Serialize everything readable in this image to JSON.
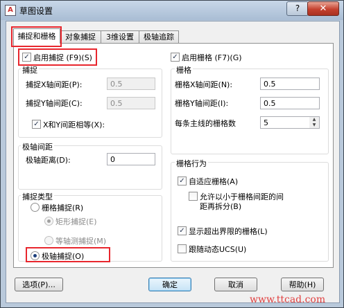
{
  "window": {
    "title": "草图设置",
    "help_label": "?",
    "close_label": "✕"
  },
  "tabs": [
    "捕捉和栅格",
    "对象捕捉",
    "3维设置",
    "极轴追踪"
  ],
  "left": {
    "snap_on_label": "启用捕捉 (F9)(S)",
    "snap_group_title": "捕捉",
    "snap_x_label": "捕捉X轴间距(P):",
    "snap_x_value": "0.5",
    "snap_y_label": "捕捉Y轴间距(C):",
    "snap_y_value": "0.5",
    "equal_xy_label": "X和Y间距相等(X):",
    "polar_group_title": "极轴间距",
    "polar_distance_label": "极轴距离(D):",
    "polar_distance_value": "0",
    "snap_type_title": "捕捉类型",
    "grid_snap_label": "栅格捕捉(R)",
    "rect_snap_label": "矩形捕捉(E)",
    "iso_snap_label": "等轴测捕捉(M)",
    "polar_snap_label": "极轴捕捉(O)"
  },
  "right": {
    "grid_on_label": "启用栅格 (F7)(G)",
    "grid_group_title": "栅格",
    "grid_x_label": "栅格X轴间距(N):",
    "grid_x_value": "0.5",
    "grid_y_label": "栅格Y轴间距(I):",
    "grid_y_value": "0.5",
    "major_line_label": "每条主线的栅格数",
    "major_line_value": "5",
    "behavior_title": "栅格行为",
    "adaptive_label": "自适应栅格(A)",
    "subdivide_label_1": "允许以小于栅格间距的间",
    "subdivide_label_2": "距再拆分(B)",
    "beyond_limits_label": "显示超出界限的栅格(L)",
    "follow_ucs_label": "跟随动态UCS(U)"
  },
  "buttons": {
    "options": "选项(P)...",
    "ok": "确定",
    "cancel": "取消",
    "help": "帮助(H)"
  },
  "watermark": "www.ttcad.com"
}
